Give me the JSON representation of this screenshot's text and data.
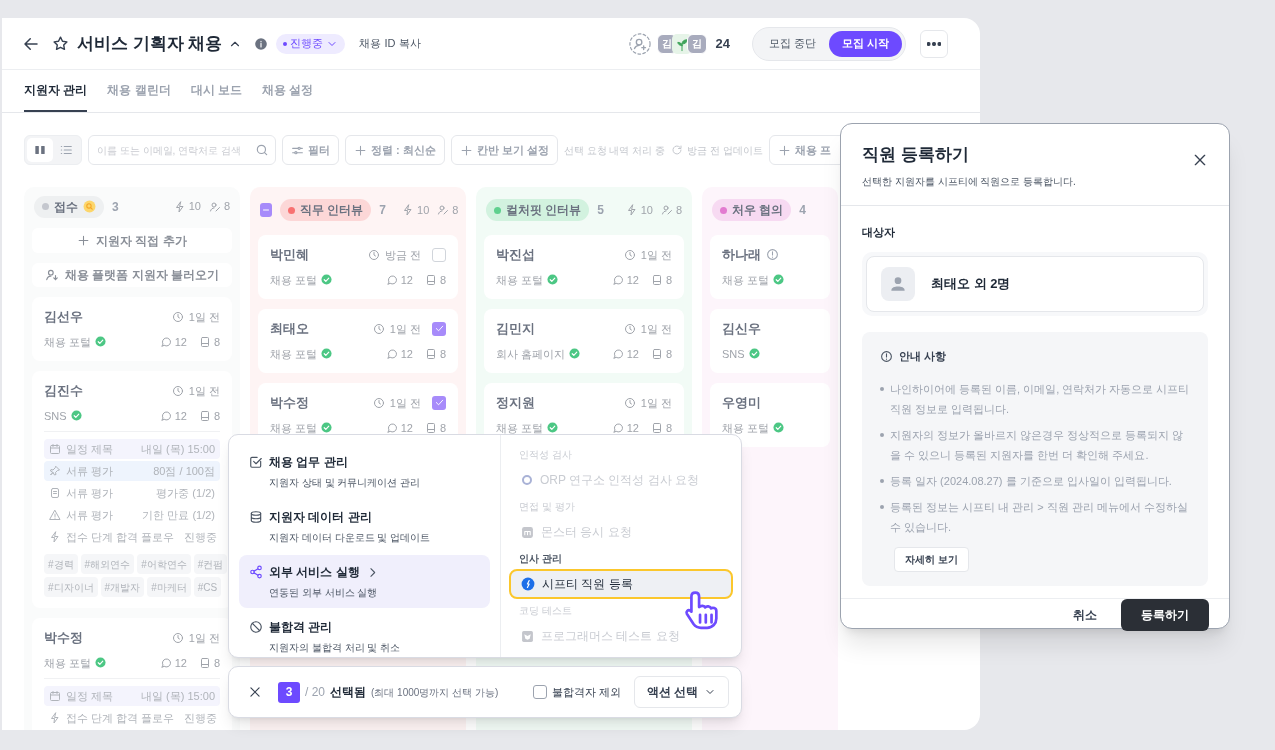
{
  "header": {
    "title": "서비스 기획자 채용",
    "status": "진행중",
    "copy_id": "채용 ID 복사",
    "avatars": [
      {
        "kind": "initial",
        "label": "김"
      },
      {
        "kind": "sprout"
      },
      {
        "kind": "initial",
        "label": "김"
      }
    ],
    "member_count": "24",
    "recruit_toggle": [
      {
        "label": "모집 중단",
        "selected": false
      },
      {
        "label": "모집 시작",
        "selected": true
      }
    ]
  },
  "tabs": [
    {
      "label": "지원자 관리",
      "selected": true
    },
    {
      "label": "채용 캘린더",
      "selected": false
    },
    {
      "label": "대시 보드",
      "selected": false
    },
    {
      "label": "채용 설정",
      "selected": false
    }
  ],
  "toolbar": {
    "views": [
      {
        "kind": "board",
        "selected": true
      },
      {
        "kind": "list",
        "selected": false
      }
    ],
    "search": {
      "placeholder": "이름 또는 이메일, 연락처로 검색"
    },
    "buttons": [
      {
        "kind": "filter",
        "label": "필터"
      },
      {
        "kind": "add",
        "label": "정렬 : 최신순"
      },
      {
        "kind": "add",
        "label": "칸반 보기 설정"
      }
    ],
    "processing": "선택 요청 내역 처리 중",
    "updated": "방금 전 업데이트",
    "add_button": "채용 프"
  },
  "columns": [
    {
      "title": "접수",
      "color": "#c4c7ce",
      "notice": true,
      "count": "3",
      "bolt": "10",
      "people": "8",
      "actions": [
        {
          "kind": "add",
          "label": "지원자 직접 추가"
        },
        {
          "kind": "import",
          "label": "채용 플랫폼 지원자 불러오기"
        }
      ],
      "cards": [
        {
          "name": "김선우",
          "time": "1일 전",
          "source": "채용 포털",
          "comments": "12",
          "files": "8"
        },
        {
          "name": "김진수",
          "time": "1일 전",
          "source": "SNS",
          "comments": "12",
          "files": "8",
          "details": [
            {
              "kind": "schedule",
              "label": "일정 제목",
              "value": "내일 (목) 15:00"
            },
            {
              "kind": "score",
              "label": "서류 평가",
              "value": "80점 / 100점"
            },
            {
              "kind": "review",
              "label": "서류 평가",
              "value": "평가중 (1/2)"
            },
            {
              "kind": "expired",
              "label": "서류 평가",
              "value": "기한 만료 (1/2)"
            },
            {
              "kind": "flow",
              "label": "접수 단계 합격 플로우",
              "value": "진행중"
            }
          ],
          "tags": [
            "#경력",
            "#해외연수",
            "#어학연수",
            "#컨펌",
            "#디자이너",
            "#개발자",
            "#마케터",
            "#CS"
          ]
        },
        {
          "name": "박수정",
          "time": "1일 전",
          "source": "채용 포털",
          "comments": "12",
          "files": "8",
          "details": [
            {
              "kind": "schedule",
              "label": "일정 제목",
              "value": "내일 (목) 15:00"
            },
            {
              "kind": "flow",
              "label": "접수 단계 합격 플로우",
              "value": "진행중"
            }
          ]
        }
      ]
    },
    {
      "title": "직무 인터뷰",
      "color": "#f87171",
      "indeterminate": true,
      "count": "7",
      "bolt": "10",
      "people": "8",
      "cards": [
        {
          "name": "박민혜",
          "time": "방금 전",
          "checked": false,
          "source": "채용 포털",
          "comments": "12",
          "files": "8"
        },
        {
          "name": "최태오",
          "time": "1일 전",
          "checked": true,
          "source": "채용 포털",
          "comments": "12",
          "files": "8"
        },
        {
          "name": "박수정",
          "time": "1일 전",
          "checked": true,
          "source": "채용 포털",
          "comments": "12",
          "files": "8"
        }
      ]
    },
    {
      "title": "컬처핏 인터뷰",
      "color": "#5fd08e",
      "count": "5",
      "bolt": "10",
      "people": "8",
      "cards": [
        {
          "name": "박진섭",
          "time": "1일 전",
          "source": "채용 포털",
          "comments": "12",
          "files": "8"
        },
        {
          "name": "김민지",
          "time": "1일 전",
          "source": "회사 홈페이지",
          "comments": "12",
          "files": "8"
        },
        {
          "name": "정지원",
          "time": "1일 전",
          "source": "채용 포털",
          "comments": "12",
          "files": "8"
        }
      ]
    },
    {
      "title": "처우 협의",
      "color": "#e27bd0",
      "count": "4",
      "cards": [
        {
          "name": "하나래",
          "alert": true,
          "source": "채용 포털"
        },
        {
          "name": "김신우",
          "source": "SNS"
        },
        {
          "name": "우영미",
          "source": "채용 포털"
        }
      ]
    }
  ],
  "action_menu": {
    "categories": [
      {
        "kind": "tasks",
        "title": "채용 업무 관리",
        "description": "지원자 상태 및 커뮤니케이션 관리",
        "selected": false
      },
      {
        "kind": "data",
        "title": "지원자 데이터 관리",
        "description": "지원자 데이터 다운로드 및 업데이트",
        "selected": false
      },
      {
        "kind": "external",
        "title": "외부 서비스 실행",
        "description": "연동된 외부 서비스 실행",
        "selected": true
      },
      {
        "kind": "reject",
        "title": "불합격 관리",
        "description": "지원자의 불합격 처리 및 취소",
        "selected": false
      }
    ],
    "groups": [
      {
        "title": "인적성 검사",
        "disabled": true,
        "items": [
          {
            "kind": "ring",
            "label": "ORP 연구소 인적성 검사 요청",
            "selected": false
          }
        ]
      },
      {
        "title": "면접 및 평가",
        "disabled": true,
        "items": [
          {
            "kind": "monster",
            "label": "몬스터 응시 요청",
            "selected": false
          }
        ]
      },
      {
        "title": "인사 관리",
        "disabled": false,
        "items": [
          {
            "kind": "shiftee",
            "label": "시프티 직원 등록",
            "selected": true
          }
        ]
      },
      {
        "title": "코딩 테스트",
        "disabled": true,
        "items": [
          {
            "kind": "programmers",
            "label": "프로그래머스 테스트 요청",
            "selected": false
          }
        ]
      }
    ]
  },
  "selection_bar": {
    "selected": "3",
    "total": "/ 20",
    "label": "선택됨",
    "hint": "(최대 1000명까지 선택 가능)",
    "exclude_rejected": {
      "label": "불합격자 제외",
      "checked": false
    },
    "action_button": "액션 선택"
  },
  "modal": {
    "title": "직원 등록하기",
    "subtitle": "선택한 지원자를 시프티에 직원으로 등록합니다.",
    "target_label": "대상자",
    "target": "최태오 외 2명",
    "notice_title": "안내 사항",
    "notices": [
      "나인하이어에 등록된 이름, 이메일, 연락처가 자동으로 시프티 직원 정보로 입력됩니다.",
      "지원자의 정보가 올바르지 않은경우 정상적으로 등록되지 않을 수 있으니 등록된 지원자를 한번 더 확인해 주세요.",
      "등록 일자 (2024.08.27) 를 기준으로 입사일이 입력됩니다.",
      "등록된 정보는 시프티 내 관리 > 직원 관리 메뉴에서 수정하실 수 있습니다."
    ],
    "more_button": "자세히 보기",
    "cancel": "취소",
    "confirm": "등록하기"
  }
}
